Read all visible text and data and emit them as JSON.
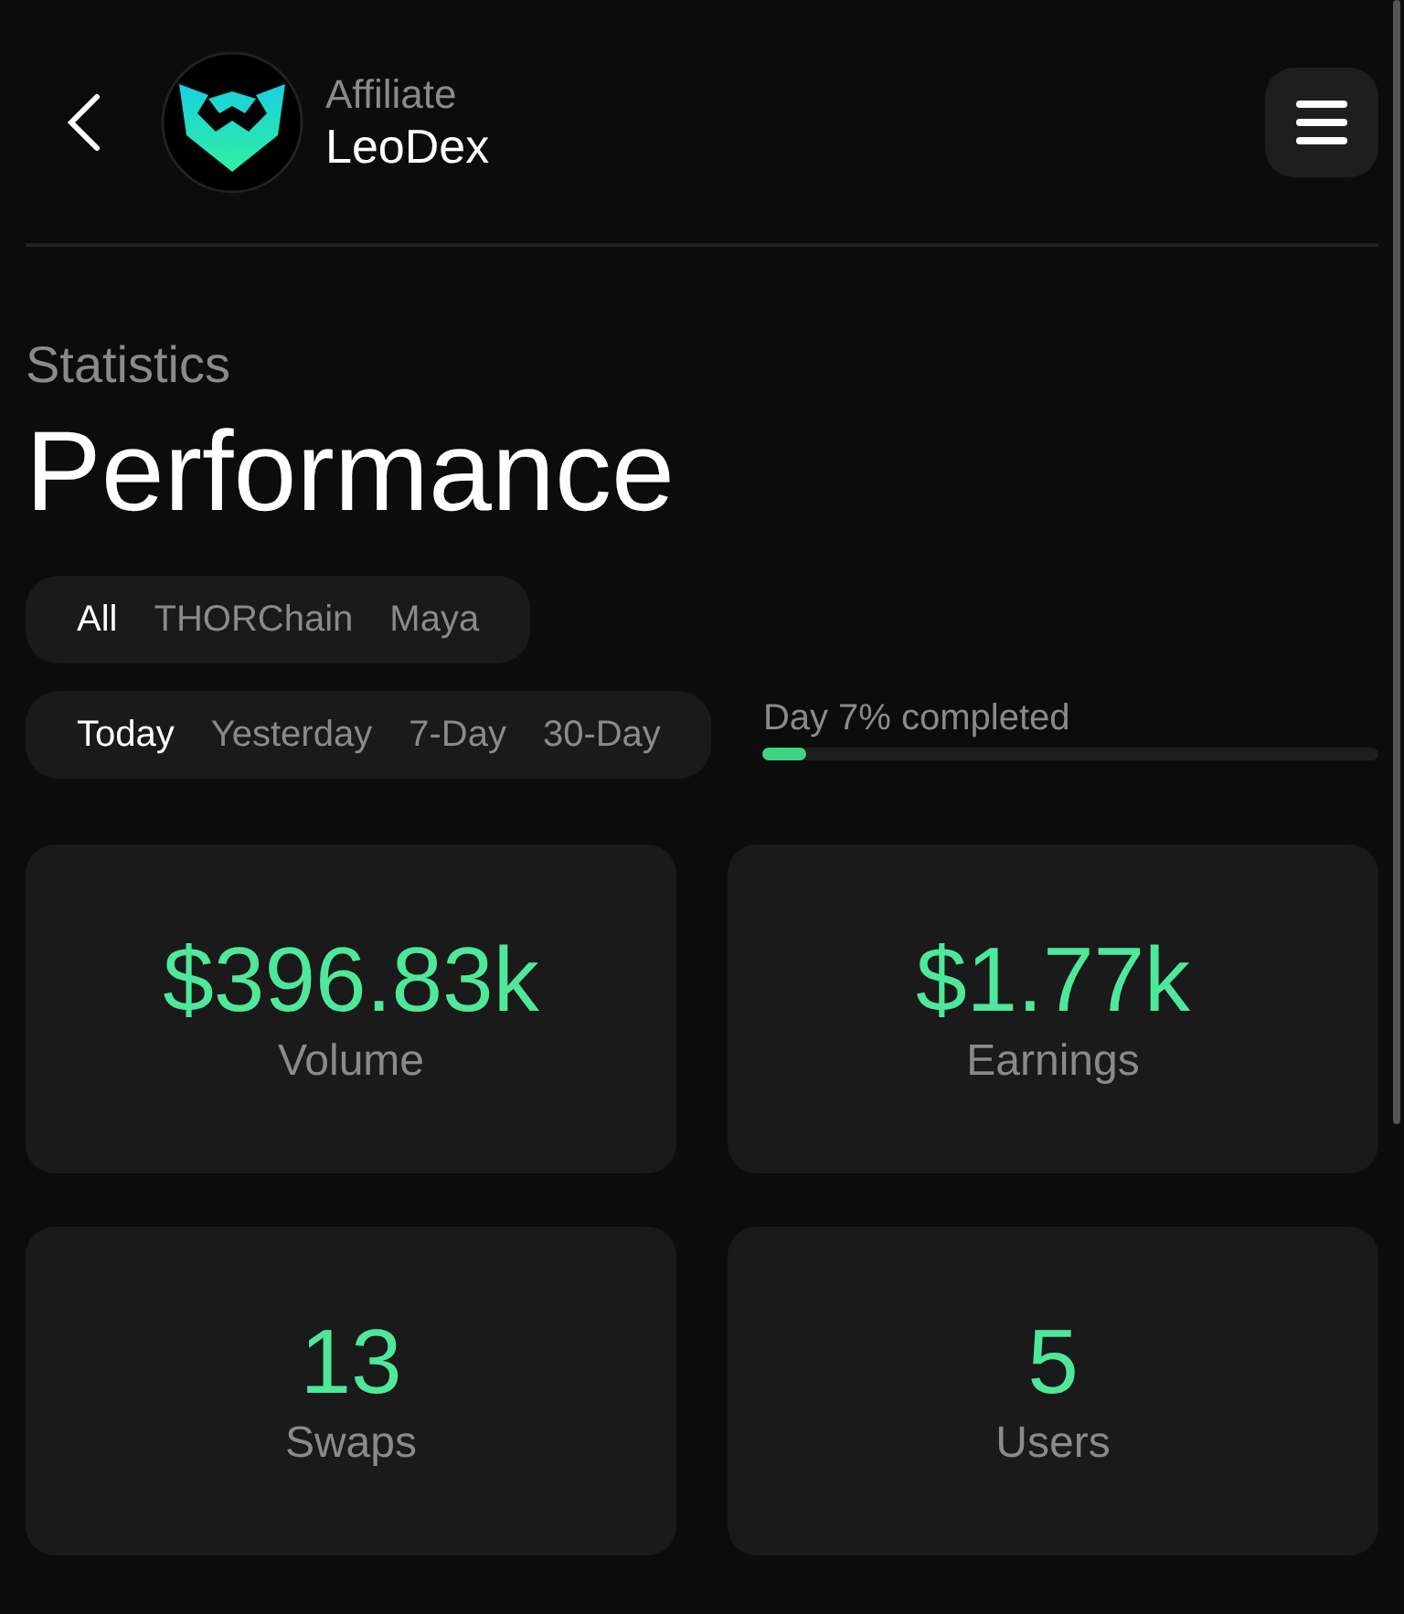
{
  "header": {
    "subtitle": "Affiliate",
    "title": "LeoDex"
  },
  "section": {
    "eyebrow": "Statistics",
    "title": "Performance"
  },
  "chain_filters": [
    {
      "label": "All",
      "selected": true
    },
    {
      "label": "THORChain",
      "selected": false
    },
    {
      "label": "Maya",
      "selected": false
    }
  ],
  "period_filters": [
    {
      "label": "Today",
      "selected": true
    },
    {
      "label": "Yesterday",
      "selected": false
    },
    {
      "label": "7-Day",
      "selected": false
    },
    {
      "label": "30-Day",
      "selected": false
    }
  ],
  "progress": {
    "label": "Day 7% completed",
    "level": 0.07
  },
  "stats": [
    {
      "value": "$396.83k",
      "label": "Volume"
    },
    {
      "value": "$1.77k",
      "label": "Earnings"
    },
    {
      "value": "13",
      "label": "Swaps"
    },
    {
      "value": "5",
      "label": "Users"
    }
  ]
}
